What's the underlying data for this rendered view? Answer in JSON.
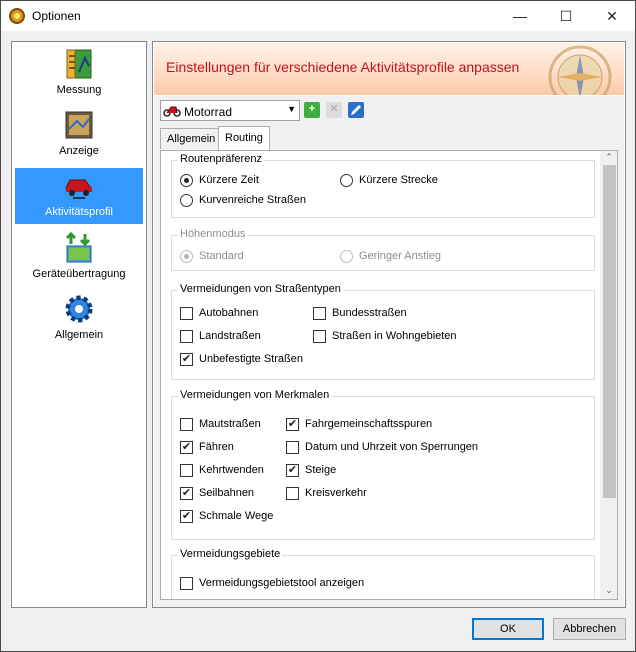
{
  "window": {
    "title": "Optionen",
    "minimize": "—",
    "maximize": "☐",
    "close": "✕"
  },
  "sidebar": {
    "items": [
      {
        "label": "Messung"
      },
      {
        "label": "Anzeige"
      },
      {
        "label": "Aktivitätsprofil"
      },
      {
        "label": "Geräteübertragung"
      },
      {
        "label": "Allgemein"
      }
    ]
  },
  "banner": {
    "title": "Einstellungen für verschiedene Aktivitätsprofile anpassen"
  },
  "profile": {
    "selected": "Motorrad"
  },
  "tabs": [
    {
      "label": "Allgemein"
    },
    {
      "label": "Routing"
    }
  ],
  "routenpraeferenz": {
    "title": "Routenpräferenz",
    "options": [
      {
        "label": "Kürzere Zeit",
        "checked": true
      },
      {
        "label": "Kürzere Strecke",
        "checked": false
      },
      {
        "label": "Kurvenreiche Straßen",
        "checked": false
      }
    ]
  },
  "hoehenmodus": {
    "title": "Höhenmodus",
    "options": [
      {
        "label": "Standard",
        "checked": true
      },
      {
        "label": "Geringer Anstieg",
        "checked": false
      }
    ]
  },
  "strassentypen": {
    "title": "Vermeidungen von Straßentypen",
    "options": [
      {
        "label": "Autobahnen",
        "checked": false
      },
      {
        "label": "Bundesstraßen",
        "checked": false
      },
      {
        "label": "Landstraßen",
        "checked": false
      },
      {
        "label": "Straßen in Wohngebieten",
        "checked": false
      },
      {
        "label": "Unbefestigte Straßen",
        "checked": true
      }
    ]
  },
  "merkmale": {
    "title": "Vermeidungen von Merkmalen",
    "options": [
      {
        "label": "Mautstraßen",
        "checked": false
      },
      {
        "label": "Fahrgemeinschaftsspuren",
        "checked": true
      },
      {
        "label": "Fähren",
        "checked": true
      },
      {
        "label": "Datum und Uhrzeit von Sperrungen",
        "checked": false
      },
      {
        "label": "Kehrtwenden",
        "checked": false
      },
      {
        "label": "Steige",
        "checked": true
      },
      {
        "label": "Seilbahnen",
        "checked": true
      },
      {
        "label": "Kreisverkehr",
        "checked": false
      },
      {
        "label": "Schmale Wege",
        "checked": true
      }
    ]
  },
  "gebiete": {
    "title": "Vermeidungsgebiete",
    "options": [
      {
        "label": "Vermeidungsgebietstool anzeigen",
        "checked": false
      }
    ]
  },
  "buttons": {
    "ok": "OK",
    "cancel": "Abbrechen"
  }
}
